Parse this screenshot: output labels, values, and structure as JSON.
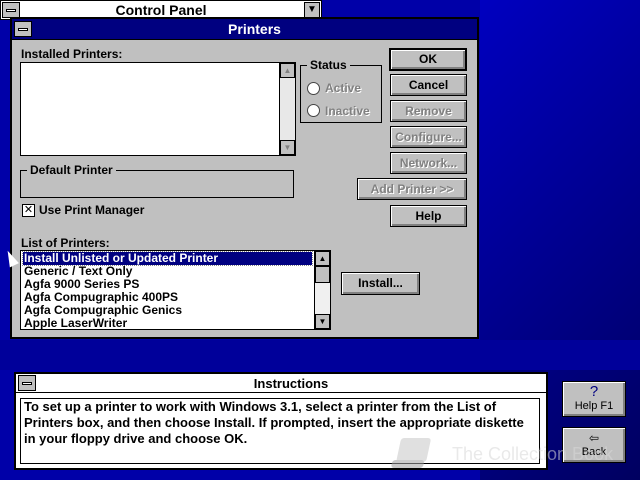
{
  "control_panel": {
    "title": "Control Panel"
  },
  "printers_dialog": {
    "title": "Printers",
    "installed_printers_label": "Installed Printers:",
    "status": {
      "label": "Status",
      "active": "Active",
      "inactive": "Inactive"
    },
    "default_printer_label": "Default Printer",
    "use_print_manager": {
      "label": "Use Print Manager",
      "checked": true
    },
    "list_of_printers_label": "List of Printers:",
    "printers_list": [
      "Install Unlisted or Updated Printer",
      "Generic / Text Only",
      "Agfa 9000 Series PS",
      "Agfa Compugraphic 400PS",
      "Agfa Compugraphic Genics",
      "Apple LaserWriter"
    ],
    "buttons": {
      "ok": "OK",
      "cancel": "Cancel",
      "remove": "Remove",
      "configure": "Configure...",
      "network": "Network...",
      "add_printer": "Add Printer >>",
      "help": "Help",
      "install": "Install..."
    }
  },
  "instructions": {
    "title": "Instructions",
    "text": "To set up a printer to work with Windows 3.1, select a printer from the List of Printers box, and then choose Install. If prompted, insert the appropriate diskette in your floppy drive and choose OK."
  },
  "side_buttons": {
    "help": "Help  F1",
    "help_symbol": "?",
    "back": "Back"
  },
  "watermark": {
    "text": "The Collection Book"
  },
  "colors": {
    "desktop": "#0000a8",
    "titlebar": "#000080",
    "face": "#c0c0c0"
  }
}
